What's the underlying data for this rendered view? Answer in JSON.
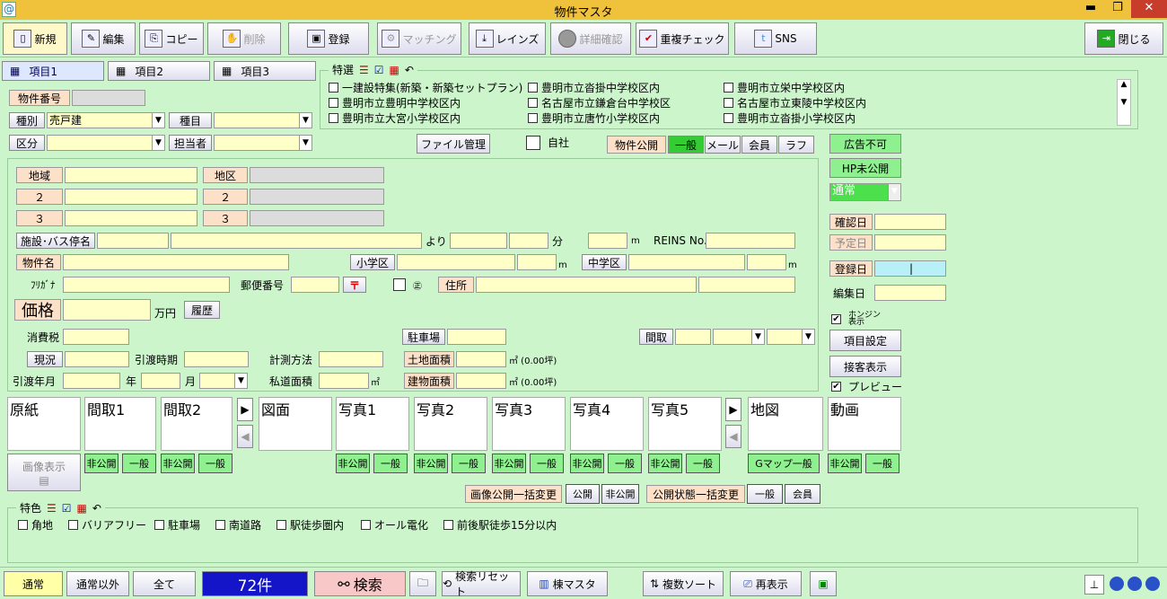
{
  "window": {
    "title": "物件マスタ",
    "app_icon": "@",
    "min": "▬",
    "max": "❐",
    "close": "✕"
  },
  "toolbar": {
    "new": "新規",
    "edit": "編集",
    "copy": "コピー",
    "delete": "削除",
    "register": "登録",
    "matching": "マッチング",
    "reins": "レインズ",
    "detail": "詳細確認",
    "dup": "重複チェック",
    "sns": "SNS",
    "close": "閉じる"
  },
  "tabs": [
    "項目1",
    "項目2",
    "項目3"
  ],
  "special": {
    "label": "特選",
    "items": [
      [
        "一建設特集(新築・新築セットプラン)",
        "豊明市立沓掛中学校区内",
        "豊明市立栄中学校区内"
      ],
      [
        "豊明市立豊明中学校区内",
        "名古屋市立鎌倉台中学校区",
        "名古屋市立東陵中学校区内"
      ],
      [
        "豊明市立大宮小学校区内",
        "豊明市立唐竹小学校区内",
        "豊明市立沓掛小学校区内"
      ]
    ]
  },
  "form": {
    "bukken_no": "物件番号",
    "shubetsu": "種別",
    "shubetsu_val": "売戸建",
    "shumoku": "種目",
    "kubun": "区分",
    "tantou": "担当者",
    "file_btn": "ファイル管理",
    "jisha": "自社",
    "pub": "物件公開",
    "pub_opts": [
      "一般",
      "メール",
      "会員",
      "ラフ"
    ],
    "chiiki": "地域",
    "chiku": "地区",
    "two": "２",
    "three": "３",
    "shisetsu": "施設･バス停名",
    "yori": "より",
    "fun": "分",
    "m": "m",
    "reins_no": "REINS No.",
    "bukken_name": "物件名",
    "shogakku": "小学区",
    "chugakku": "中学区",
    "furigana": "ﾌﾘｶﾞﾅ",
    "yubin": "郵便番号",
    "yubin_mark": "〒",
    "sama": "㊣",
    "jusho": "住所",
    "kakaku": "価格",
    "manyen": "万円",
    "rireki": "履歴",
    "shouhizei": "消費税",
    "chushajo": "駐車場",
    "madori": "間取",
    "genkyo": "現況",
    "hikiwatashi": "引渡時期",
    "keisoku": "計測方法",
    "tochi": "土地面積",
    "tochi_unit": "㎡ (0.00坪)",
    "hikiwatashi_ym": "引渡年月",
    "nen": "年",
    "tsuki": "月",
    "shidou": "私道面積",
    "sqm": "㎡",
    "tatemono": "建物面積",
    "tatemono_unit": "㎡ (0.00坪)"
  },
  "right": {
    "ad_ng": "広告不可",
    "hp": "HP未公開",
    "status": "通常",
    "kakunin": "確認日",
    "yotei": "予定日",
    "toroku": "登録日",
    "toroku_val": "|",
    "henshu": "編集日",
    "kensaku_label": "ホンジン\n表示",
    "item_set": "項目設定",
    "sekkyaku": "接客表示",
    "preview": "プレビュー"
  },
  "images": {
    "labels": [
      "原紙",
      "間取1",
      "間取2",
      "図面",
      "写真1",
      "写真2",
      "写真3",
      "写真4",
      "写真5",
      "地図",
      "動画"
    ],
    "hikoukai": "非公開",
    "ippan": "一般",
    "gmap": "Gマップ一般",
    "show": "画像表示",
    "bulk_img": "画像公開一括変更",
    "kokai": "公開",
    "hikokai": "非公開",
    "bulk_status": "公開状態一括変更",
    "b_ippan": "一般",
    "b_kaiin": "会員"
  },
  "features": {
    "label": "特色",
    "items": [
      "角地",
      "バリアフリー",
      "駐車場",
      "南道路",
      "駅徒歩圏内",
      "オール電化",
      "前後駅徒歩15分以内"
    ]
  },
  "status": {
    "normal": "通常",
    "other": "通常以外",
    "all": "全て",
    "count": "72件",
    "search": "検索",
    "reset": "検索リセット",
    "tou": "棟マスタ",
    "sort": "複数ソート",
    "redisplay": "再表示"
  }
}
